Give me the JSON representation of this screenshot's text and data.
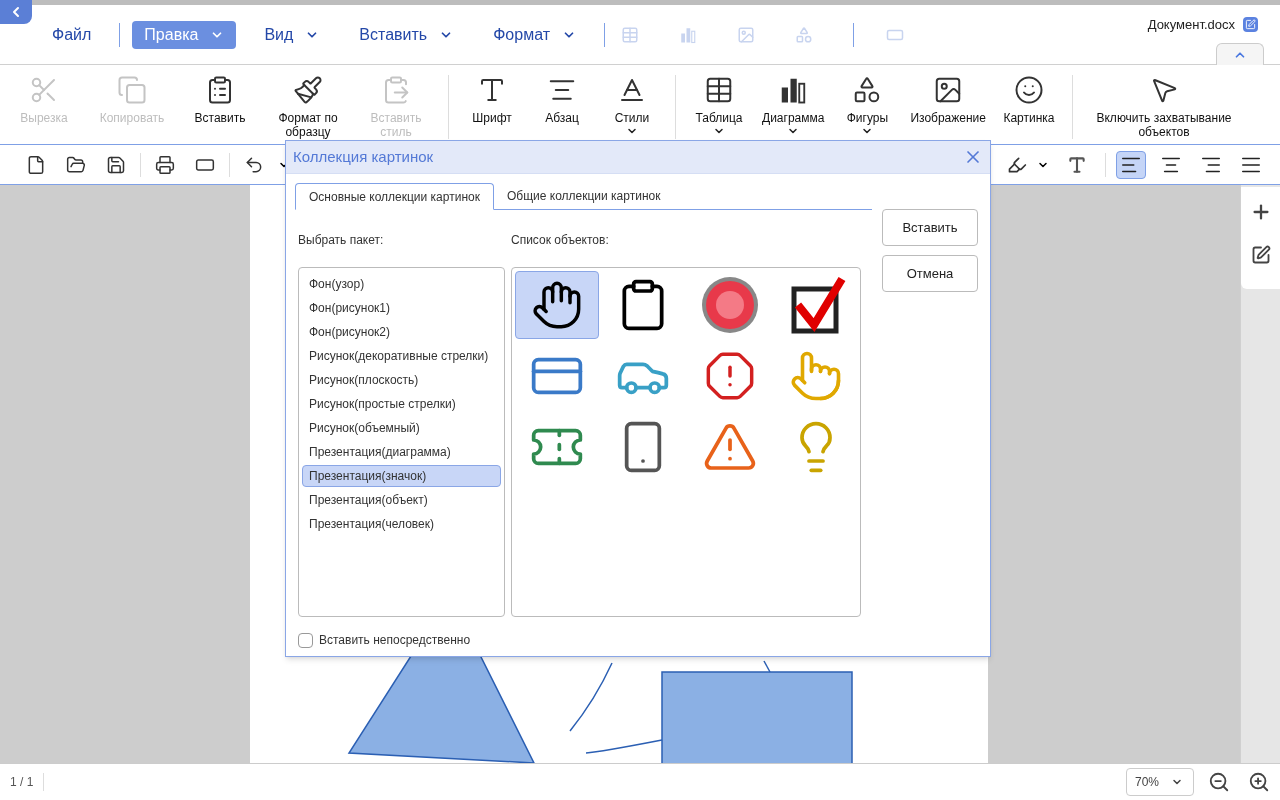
{
  "document": {
    "title": "Документ.docx"
  },
  "menu": [
    {
      "label": "Файл",
      "selected": false,
      "dropdown": false
    },
    {
      "label": "Правка",
      "selected": true,
      "dropdown": true
    },
    {
      "label": "Вид",
      "selected": false,
      "dropdown": true
    },
    {
      "label": "Вставить",
      "selected": false,
      "dropdown": true
    },
    {
      "label": "Формат",
      "selected": false,
      "dropdown": true
    }
  ],
  "quick_icons": [
    {
      "kind": "table",
      "disabled": true
    },
    {
      "kind": "chart",
      "disabled": true
    },
    {
      "kind": "image",
      "disabled": true
    },
    {
      "kind": "shapes",
      "disabled": true
    },
    {
      "kind": "textbox",
      "disabled": true
    }
  ],
  "ribbon_groups": [
    {
      "items": [
        {
          "kind": "cut",
          "label": "Вырезка",
          "disabled": true,
          "dropdown": false
        },
        {
          "kind": "copy",
          "label": "Копировать",
          "disabled": true,
          "dropdown": false
        },
        {
          "kind": "paste",
          "label": "Вставить",
          "disabled": false,
          "dropdown": false
        },
        {
          "kind": "format-painter",
          "label": "Формат по образцу",
          "disabled": false,
          "dropdown": false
        },
        {
          "kind": "paste-style",
          "label": "Вставить стиль",
          "disabled": true,
          "dropdown": false
        }
      ]
    },
    {
      "items": [
        {
          "kind": "font",
          "label": "Шрифт",
          "disabled": false,
          "dropdown": false
        },
        {
          "kind": "paragraph",
          "label": "Абзац",
          "disabled": false,
          "dropdown": false
        },
        {
          "kind": "styles",
          "label": "Стили",
          "disabled": false,
          "dropdown": true
        }
      ]
    },
    {
      "items": [
        {
          "kind": "table",
          "label": "Таблица",
          "disabled": false,
          "dropdown": true
        },
        {
          "kind": "chart",
          "label": "Диаграмма",
          "disabled": false,
          "dropdown": true
        },
        {
          "kind": "shapes",
          "label": "Фигуры",
          "disabled": false,
          "dropdown": true
        },
        {
          "kind": "image",
          "label": "Изображение",
          "disabled": false,
          "dropdown": false
        },
        {
          "kind": "picture",
          "label": "Картинка",
          "disabled": false,
          "dropdown": false
        }
      ]
    },
    {
      "items": [
        {
          "kind": "select-objects",
          "label": "Включить захватывание объектов",
          "disabled": false,
          "dropdown": false
        }
      ]
    }
  ],
  "alignment": [
    {
      "kind": "left",
      "selected": true
    },
    {
      "kind": "center",
      "selected": false
    },
    {
      "kind": "right",
      "selected": false
    },
    {
      "kind": "justify",
      "selected": false
    }
  ],
  "dialog": {
    "title": "Коллекция картинок",
    "tabs": [
      {
        "label": "Основные коллекции картинок",
        "selected": true
      },
      {
        "label": "Общие коллекции картинок",
        "selected": false
      }
    ],
    "package_label": "Выбрать пакет:",
    "packages": [
      {
        "label": "Фон(узор)",
        "selected": false
      },
      {
        "label": "Фон(рисунок1)",
        "selected": false
      },
      {
        "label": "Фон(рисунок2)",
        "selected": false
      },
      {
        "label": "Рисунок(декоративные стрелки)",
        "selected": false
      },
      {
        "label": "Рисунок(плоскость)",
        "selected": false
      },
      {
        "label": "Рисунок(простые стрелки)",
        "selected": false
      },
      {
        "label": "Рисунок(объемный)",
        "selected": false
      },
      {
        "label": "Презентация(диаграмма)",
        "selected": false
      },
      {
        "label": "Презентация(значок)",
        "selected": true
      },
      {
        "label": "Презентация(объект)",
        "selected": false
      },
      {
        "label": "Презентация(человек)",
        "selected": false
      }
    ],
    "objects_label": "Список объектов:",
    "objects": [
      {
        "kind": "hand",
        "selected": true
      },
      {
        "kind": "clipboard",
        "selected": false
      },
      {
        "kind": "button",
        "selected": false
      },
      {
        "kind": "checkbox",
        "selected": false
      },
      {
        "kind": "cards",
        "selected": false
      },
      {
        "kind": "car",
        "selected": false
      },
      {
        "kind": "stop",
        "selected": false
      },
      {
        "kind": "pointer",
        "selected": false
      },
      {
        "kind": "tickets",
        "selected": false
      },
      {
        "kind": "phone",
        "selected": false
      },
      {
        "kind": "alert",
        "selected": false
      },
      {
        "kind": "lightbulb",
        "selected": false
      }
    ],
    "buttons": [
      "Вставить",
      "Отмена"
    ],
    "insert_directly": {
      "label": "Вставить непосредственно",
      "checked": false
    }
  },
  "status_bar": {
    "page": "1 / 1",
    "zoom": "70%"
  }
}
